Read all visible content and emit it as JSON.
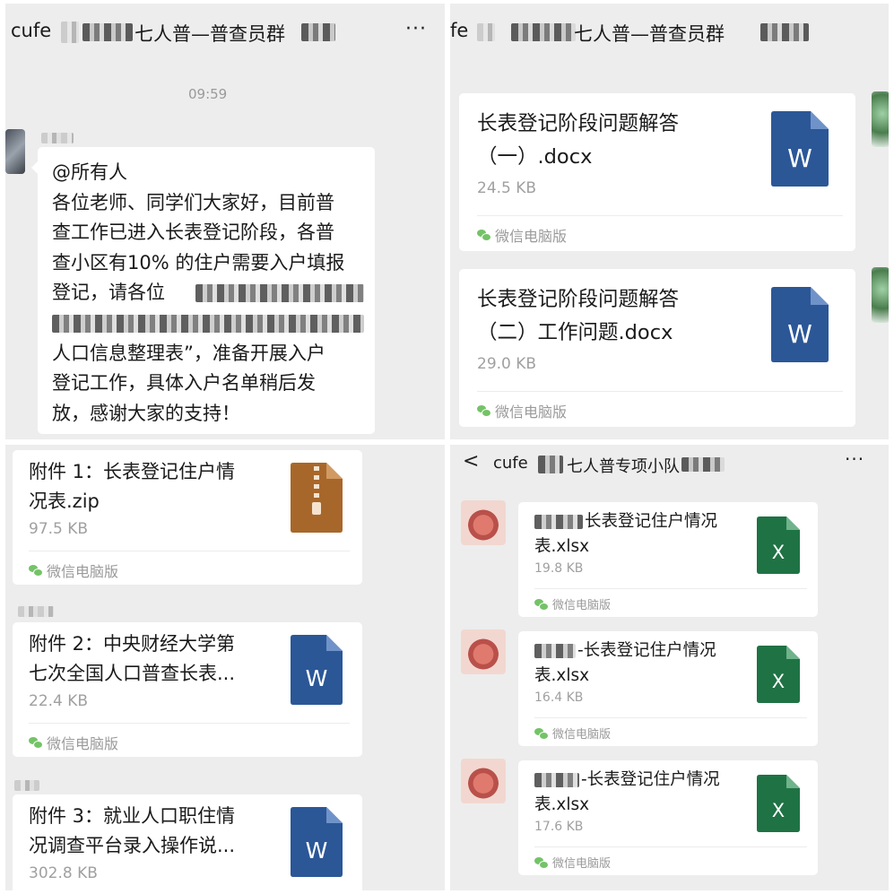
{
  "top_left": {
    "chat_title_prefix": "cufe",
    "chat_title_suffix": "七人普—普查员群",
    "more_icon": "···",
    "timestamp": "09:59",
    "message_lines": [
      "@所有人",
      "各位老师、同学们大家好，目前普",
      "查工作已进入长表登记阶段，各普",
      "查小区有10% 的住户需要入户填报",
      "登记，请各位",
      "",
      "人口信息整理表”，准备开展入户",
      "登记工作，具体入户名单稍后发",
      "放，感谢大家的支持！"
    ]
  },
  "top_right": {
    "chat_title_prefix": "fe",
    "chat_title_suffix": "七人普—普查员群",
    "files": [
      {
        "name_lines": [
          "长表登记阶段问题解答",
          "（一）.docx"
        ],
        "size": "24.5 KB",
        "source": "微信电脑版",
        "icon": "word-doc-icon",
        "icon_letter": "W"
      },
      {
        "name_lines": [
          "长表登记阶段问题解答",
          "（二）工作问题.docx"
        ],
        "size": "29.0 KB",
        "source": "微信电脑版",
        "icon": "word-doc-icon",
        "icon_letter": "W"
      }
    ]
  },
  "bottom_left": {
    "files": [
      {
        "name_lines": [
          "附件 1：长表登记住户情",
          "况表.zip"
        ],
        "size": "97.5 KB",
        "source": "微信电脑版",
        "icon": "zip-archive-icon"
      },
      {
        "name_lines": [
          "附件 2：中央财经大学第",
          "七次全国人口普查长表..."
        ],
        "size": "22.4 KB",
        "source": "微信电脑版",
        "icon": "word-doc-icon",
        "icon_letter": "W"
      },
      {
        "name_lines": [
          "附件 3：就业人口职住情",
          "况调查平台录入操作说..."
        ],
        "size": "302.8 KB",
        "source": "",
        "icon": "word-doc-icon",
        "icon_letter": "W"
      }
    ]
  },
  "bottom_right": {
    "back_icon": "<",
    "chat_title_prefix": "cufe",
    "chat_title_suffix": "七人普专项小队",
    "more_icon": "···",
    "files": [
      {
        "name_lines": [
          "长表登记住户情况",
          "表.xlsx"
        ],
        "size": "19.8 KB",
        "source": "微信电脑版",
        "icon": "excel-sheet-icon",
        "icon_letter": "X"
      },
      {
        "name_lines": [
          "-长表登记住户情况",
          "表.xlsx"
        ],
        "size": "16.4 KB",
        "source": "微信电脑版",
        "icon": "excel-sheet-icon",
        "icon_letter": "X"
      },
      {
        "name_lines": [
          "-长表登记住户情况",
          "表.xlsx"
        ],
        "size": "17.6 KB",
        "source": "微信电脑版",
        "icon": "excel-sheet-icon",
        "icon_letter": "X"
      }
    ]
  },
  "colors": {
    "panel_bg": "#ededed",
    "bubble_bg": "#ffffff",
    "word_blue": "#2b5797",
    "excel_green": "#1f7244",
    "zip_brown": "#a8672a",
    "meta_gray": "#a0a0a0",
    "wechat_green": "#74c367"
  }
}
